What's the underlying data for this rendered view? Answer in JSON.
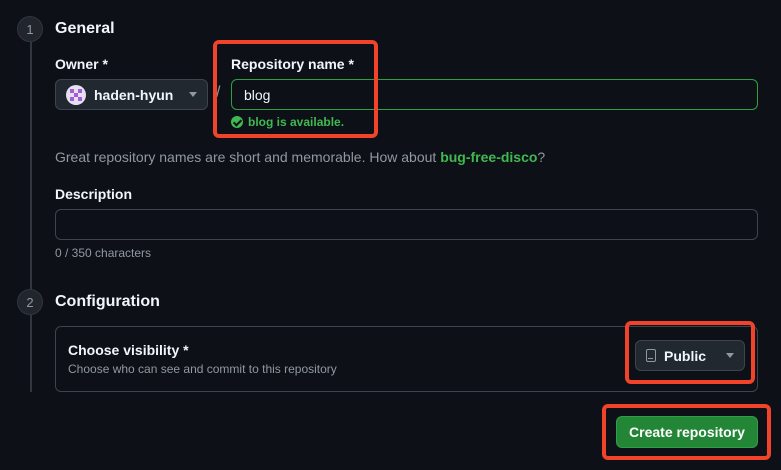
{
  "steps": [
    {
      "number": "1",
      "title": "General"
    },
    {
      "number": "2",
      "title": "Configuration"
    }
  ],
  "owner": {
    "label": "Owner *",
    "value": "haden-hyun"
  },
  "separator": "/",
  "repo_name": {
    "label": "Repository name *",
    "value": "blog",
    "availability": "blog is available."
  },
  "hint": {
    "text": "Great repository names are short and memorable. How about ",
    "suggestion": "bug-free-disco",
    "suffix": "?"
  },
  "description": {
    "label": "Description",
    "value": "",
    "counter": "0 / 350 characters"
  },
  "visibility": {
    "title": "Choose visibility *",
    "subtitle": "Choose who can see and commit to this repository",
    "selected": "Public"
  },
  "create_button": "Create repository",
  "colors": {
    "background": "#0d1117",
    "success": "#3fb950",
    "primary_button": "#238636",
    "highlight": "#f0432a"
  }
}
